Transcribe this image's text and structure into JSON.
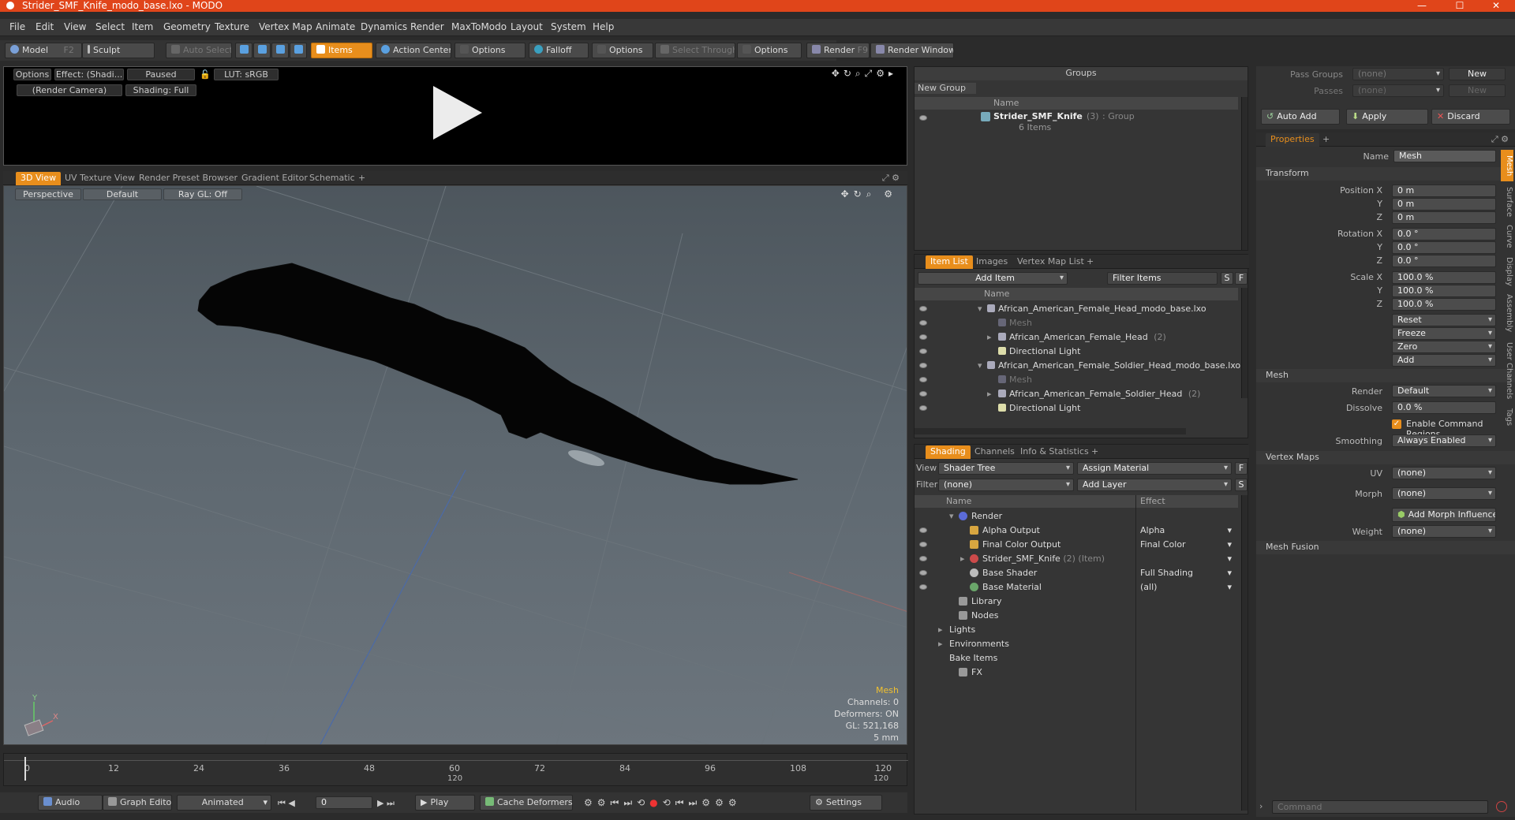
{
  "window": {
    "title": "Strider_SMF_Knife_modo_base.lxo - MODO",
    "minimize": "—",
    "maximize": "☐",
    "close": "✕"
  },
  "menu": [
    "File",
    "Edit",
    "View",
    "Select",
    "Item",
    "Geometry",
    "Texture",
    "Vertex Map",
    "Animate",
    "Dynamics",
    "Render",
    "MaxToModo",
    "Layout",
    "System",
    "Help"
  ],
  "toolbar": {
    "model": "Model",
    "model_key": "F2",
    "sculpt": "Sculpt",
    "auto_select": "Auto Select",
    "items": "Items",
    "action_center": "Action Center",
    "options1": "Options",
    "falloff": "Falloff",
    "options2": "Options",
    "select_through": "Select Through",
    "options3": "Options",
    "render": "Render",
    "render_key": "F9",
    "render_window": "Render Window"
  },
  "preview": {
    "options": "Options",
    "effect": "Effect: (Shadi...",
    "paused": "Paused",
    "lut": "LUT: sRGB",
    "camera": "(Render Camera)",
    "shading": "Shading: Full"
  },
  "view_tabs": [
    "3D View",
    "UV Texture View",
    "Render Preset Browser",
    "Gradient Editor",
    "Schematic"
  ],
  "viewport": {
    "perspective": "Perspective",
    "default": "Default",
    "raygl": "Ray GL: Off",
    "hud": [
      "Mesh",
      "Channels: 0",
      "Deformers: ON",
      "GL: 521,168",
      "5 mm"
    ]
  },
  "timeline": {
    "ticks": [
      "0",
      "12",
      "24",
      "36",
      "48",
      "60",
      "72",
      "84",
      "96",
      "108",
      "120"
    ],
    "sub_ticks": [
      "120",
      "120"
    ]
  },
  "transport": {
    "audio": "Audio",
    "graph_editor": "Graph Editor",
    "animated": "Animated",
    "frame": "0",
    "play": "Play",
    "cache_deformers": "Cache Deformers",
    "settings": "Settings"
  },
  "groups": {
    "title": "Groups",
    "new_group": "New Group",
    "col_name": "Name",
    "item_name": "Strider_SMF_Knife",
    "item_count": "(3)",
    "item_type": ": Group",
    "item_sub": "6 Items"
  },
  "item_list": {
    "tabs": [
      "Item List",
      "Images",
      "Vertex Map List"
    ],
    "add_item": "Add Item",
    "filter": "Filter Items",
    "s": "S",
    "f": "F",
    "col_name": "Name",
    "rows": [
      {
        "label": "African_American_Female_Head_modo_base.lxo",
        "indent": 0,
        "dim": false
      },
      {
        "label": "Mesh",
        "indent": 2,
        "dim": true
      },
      {
        "label": "African_American_Female_Head",
        "count": "(2)",
        "indent": 2,
        "dim": false
      },
      {
        "label": "Directional Light",
        "indent": 2,
        "dim": false
      },
      {
        "label": "African_American_Female_Soldier_Head_modo_base.lxo",
        "indent": 0,
        "dim": false
      },
      {
        "label": "Mesh",
        "indent": 2,
        "dim": true
      },
      {
        "label": "African_American_Female_Soldier_Head",
        "count": "(2)",
        "indent": 2,
        "dim": false
      },
      {
        "label": "Directional Light",
        "indent": 2,
        "dim": false
      }
    ]
  },
  "shading": {
    "tabs": [
      "Shading",
      "Channels",
      "Info & Statistics"
    ],
    "view_label": "View",
    "view_value": "Shader Tree",
    "assign": "Assign Material",
    "f": "F",
    "filter_label": "Filter",
    "filter_value": "(none)",
    "add_layer": "Add Layer",
    "s": "S",
    "col_name": "Name",
    "col_effect": "Effect",
    "rows": [
      {
        "label": "Render",
        "effect": "",
        "indent": 1
      },
      {
        "label": "Alpha Output",
        "effect": "Alpha",
        "indent": 2
      },
      {
        "label": "Final Color Output",
        "effect": "Final Color",
        "indent": 2
      },
      {
        "label": "Strider_SMF_Knife",
        "suffix": "(2) (Item)",
        "effect": "",
        "indent": 2
      },
      {
        "label": "Base Shader",
        "effect": "Full Shading",
        "indent": 2
      },
      {
        "label": "Base Material",
        "effect": "(all)",
        "indent": 2
      },
      {
        "label": "Library",
        "effect": "",
        "indent": 1
      },
      {
        "label": "Nodes",
        "effect": "",
        "indent": 1
      },
      {
        "label": "Lights",
        "effect": "",
        "indent": 0
      },
      {
        "label": "Environments",
        "effect": "",
        "indent": 0
      },
      {
        "label": "Bake Items",
        "effect": "",
        "indent": 0
      },
      {
        "label": "FX",
        "effect": "",
        "indent": 1
      }
    ]
  },
  "pass": {
    "pass_groups": "Pass Groups",
    "passes": "Passes",
    "none": "(none)",
    "new": "New",
    "auto_add": "Auto Add",
    "apply": "Apply",
    "discard": "Discard"
  },
  "properties": {
    "tab": "Properties",
    "name_label": "Name",
    "name_value": "Mesh",
    "transform": "Transform",
    "position_label": "Position X",
    "y": "Y",
    "z": "Z",
    "pos": [
      "0 m",
      "0 m",
      "0 m"
    ],
    "rotation_label": "Rotation X",
    "rot": [
      "0.0 °",
      "0.0 °",
      "0.0 °"
    ],
    "scale_label": "Scale X",
    "scl": [
      "100.0 %",
      "100.0 %",
      "100.0 %"
    ],
    "actions": [
      "Reset",
      "Freeze",
      "Zero",
      "Add"
    ],
    "mesh": "Mesh",
    "render_label": "Render",
    "render_value": "Default",
    "dissolve_label": "Dissolve",
    "dissolve_value": "0.0 %",
    "enable_cmd": "Enable Command Regions",
    "smoothing_label": "Smoothing",
    "smoothing_value": "Always Enabled",
    "vertex_maps": "Vertex Maps",
    "uv_label": "UV",
    "uv_value": "(none)",
    "morph_label": "Morph",
    "morph_value": "(none)",
    "add_morph": "Add Morph Influence",
    "weight_label": "Weight",
    "weight_value": "(none)",
    "mesh_fusion": "Mesh Fusion",
    "side_tabs": [
      "Mesh",
      "Surface",
      "Curve",
      "Display",
      "Assembly",
      "User Channels",
      "Tags"
    ]
  },
  "command": {
    "placeholder": "Command"
  },
  "colors": {
    "accent": "#e88e1c",
    "titlebar": "#e0451a"
  }
}
